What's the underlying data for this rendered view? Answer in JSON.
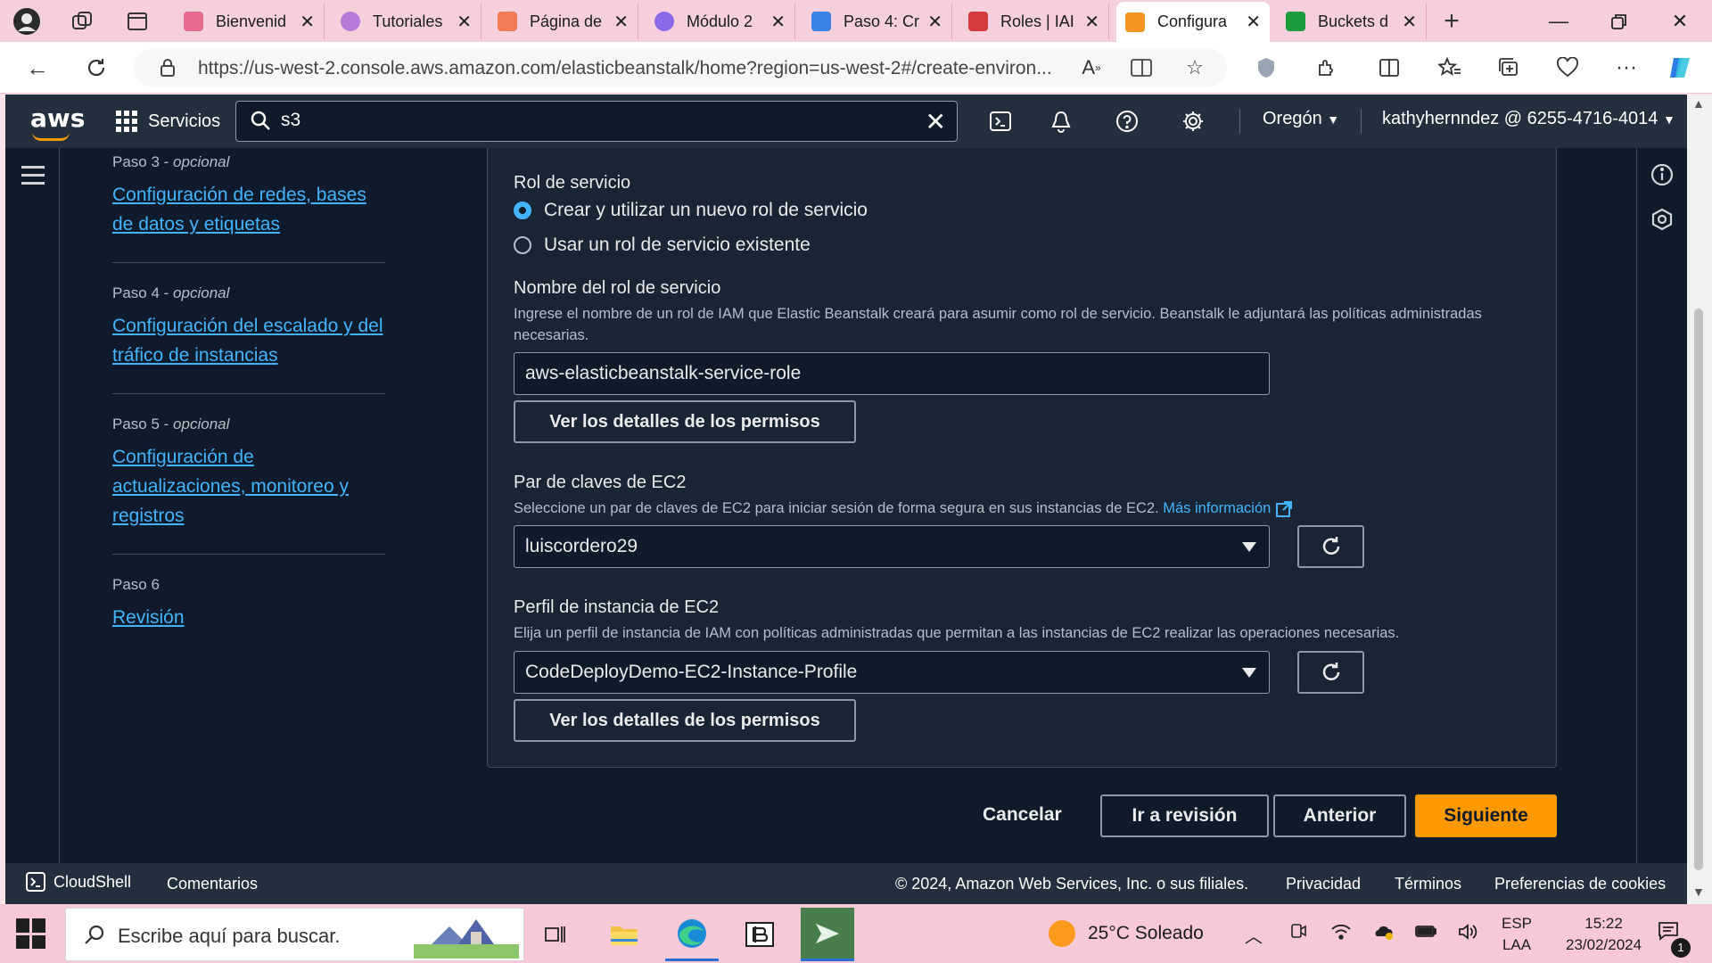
{
  "browser": {
    "tabs": [
      {
        "label": "Bienvenid",
        "color": "#e66b8e"
      },
      {
        "label": "Tutoriales",
        "color": "#b77ad8"
      },
      {
        "label": "Página de",
        "color": "#f07b56"
      },
      {
        "label": "Módulo 2",
        "color": "#8a6ae8"
      },
      {
        "label": "Paso 4: Cr",
        "color": "#3c83e8"
      },
      {
        "label": "Roles | IAI",
        "color": "#d63b3b"
      },
      {
        "label": "Configura",
        "color": "#f59423"
      },
      {
        "label": "Buckets d",
        "color": "#1c9b3a"
      }
    ],
    "url": "https://us-west-2.console.aws.amazon.com/elasticbeanstalk/home?region=us-west-2#/create-environ..."
  },
  "aws_nav": {
    "logo": "aws",
    "services_label": "Servicios",
    "search_value": "s3",
    "region": "Oregón",
    "account": "kathyhernndez @ 6255-4716-4014"
  },
  "steps": [
    {
      "title": "Paso 3",
      "optional": "opcional",
      "link": "Configuración de redes, bases de datos y etiquetas"
    },
    {
      "title": "Paso 4",
      "optional": "opcional",
      "link": "Configuración del escalado y del tráfico de instancias"
    },
    {
      "title": "Paso 5",
      "optional": "opcional",
      "link": "Configuración de actualizaciones, monitoreo y registros"
    },
    {
      "title": "Paso 6",
      "optional": "",
      "link": "Revisión"
    }
  ],
  "form": {
    "service_role_label": "Rol de servicio",
    "radio_new": "Crear y utilizar un nuevo rol de servicio",
    "radio_existing": "Usar un rol de servicio existente",
    "role_name_label": "Nombre del rol de servicio",
    "role_name_desc": "Ingrese el nombre de un rol de IAM que Elastic Beanstalk creará para asumir como rol de servicio. Beanstalk le adjuntará las políticas administradas necesarias.",
    "role_name_value": "aws-elasticbeanstalk-service-role",
    "view_permissions_1": "Ver los detalles de los permisos",
    "keypair_label": "Par de claves de EC2",
    "keypair_desc": "Seleccione un par de claves de EC2 para iniciar sesión de forma segura en sus instancias de EC2.",
    "keypair_more": "Más información",
    "keypair_value": "luiscordero29",
    "profile_label": "Perfil de instancia de EC2",
    "profile_desc": "Elija un perfil de instancia de IAM con políticas administradas que permitan a las instancias de EC2 realizar las operaciones necesarias.",
    "profile_value": "CodeDeployDemo-EC2-Instance-Profile",
    "view_permissions_2": "Ver los detalles de los permisos"
  },
  "actions": {
    "cancel": "Cancelar",
    "review": "Ir a revisión",
    "previous": "Anterior",
    "next": "Siguiente"
  },
  "footer": {
    "cloudshell": "CloudShell",
    "feedback": "Comentarios",
    "copyright": "© 2024, Amazon Web Services, Inc. o sus filiales.",
    "privacy": "Privacidad",
    "terms": "Términos",
    "cookies": "Preferencias de cookies"
  },
  "taskbar": {
    "search_placeholder": "Escribe aquí para buscar.",
    "weather": "25°C  Soleado",
    "lang_top": "ESP",
    "lang_bottom": "LAA",
    "time": "15:22",
    "date": "23/02/2024",
    "notifications": "1"
  },
  "colors": {
    "aws_nav": "#232f3e",
    "page_bg": "#0f1b2a",
    "link": "#42b4ff",
    "primary": "#ff9900"
  }
}
